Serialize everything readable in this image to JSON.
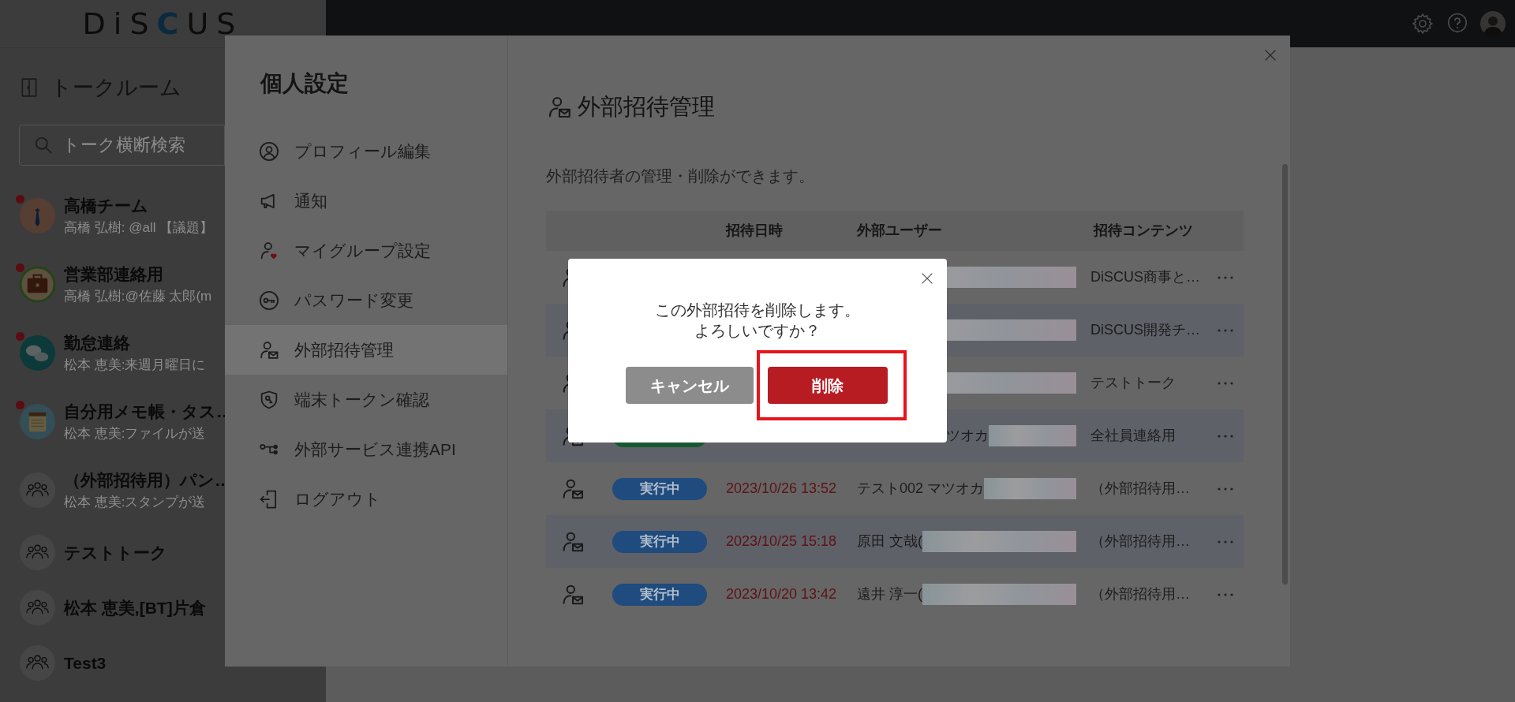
{
  "header": {
    "logo": "DiSCUS"
  },
  "sidebar": {
    "title": "トークルーム",
    "search": {
      "placeholder": "トーク横断検索"
    },
    "rooms": [
      {
        "name": "高橋チーム",
        "preview": "高橋 弘樹: @all 【議題】",
        "unread": true,
        "kind": "tie"
      },
      {
        "name": "営業部連絡用",
        "preview": "高橋 弘樹:@佐藤 太郎(m",
        "unread": true,
        "kind": "briefcase"
      },
      {
        "name": "勤怠連絡",
        "preview": "松本 恵美:来週月曜日に",
        "unread": true,
        "kind": "chat"
      },
      {
        "name": "自分用メモ帳・タス…",
        "preview": "松本 恵美:ファイルが送",
        "unread": true,
        "kind": "notepad"
      },
      {
        "name": "（外部招待用）パン…",
        "preview": "松本 恵美:スタンプが送",
        "unread": false,
        "kind": "group"
      },
      {
        "name": "テストトーク",
        "unread": false,
        "kind": "group"
      },
      {
        "name": "松本 恵美,[BT]片倉",
        "unread": false,
        "kind": "group"
      },
      {
        "name": "Test3",
        "unread": false,
        "kind": "group"
      }
    ]
  },
  "settings": {
    "title": "個人設定",
    "menu": [
      {
        "label": "プロフィール編集",
        "kind": "profile",
        "selected": false
      },
      {
        "label": "通知",
        "kind": "notification",
        "selected": false
      },
      {
        "label": "マイグループ設定",
        "kind": "mygroup",
        "selected": false
      },
      {
        "label": "パスワード変更",
        "kind": "password",
        "selected": false
      },
      {
        "label": "外部招待管理",
        "kind": "invite",
        "selected": true
      },
      {
        "label": "端末トークン確認",
        "kind": "token",
        "selected": false
      },
      {
        "label": "外部サービス連携API",
        "kind": "api",
        "selected": false
      },
      {
        "label": "ログアウト",
        "kind": "logout",
        "selected": false
      }
    ],
    "page_title": "外部招待管理",
    "description": "外部招待者の管理・削除ができます。",
    "table": {
      "columns": [
        "招待日時",
        "外部ユーザー",
        "招待コンテンツ"
      ],
      "rows": [
        {
          "content": "DiSCUS商事と…"
        },
        {
          "content": "DiSCUS開発チ…"
        },
        {
          "content": "テストトーク"
        },
        {
          "status": {
            "color": "#145a2e"
          },
          "user": "ツオカ",
          "content": "全社員連絡用"
        },
        {
          "status": {
            "label": "実行中",
            "color": "#1f4b7e"
          },
          "date": "2023/10/26 13:52",
          "user": "テスト002 マツオカ",
          "content": "（外部招待用…"
        },
        {
          "status": {
            "label": "実行中",
            "color": "#1f4b7e"
          },
          "date": "2023/10/25 15:18",
          "user": "原田 文哉(",
          "content": "（外部招待用…"
        },
        {
          "status": {
            "label": "実行中",
            "color": "#1f4b7e"
          },
          "date": "2023/10/20 13:42",
          "user": "遠井 淳一(",
          "content": "（外部招待用…"
        }
      ]
    }
  },
  "dialog": {
    "message": "この外部招待を削除します。よろしいですか？",
    "buttons": [
      {
        "label": "キャンセル",
        "kind": "cancel",
        "highlighted": false
      },
      {
        "label": "削除",
        "kind": "delete",
        "highlighted": true
      }
    ]
  }
}
